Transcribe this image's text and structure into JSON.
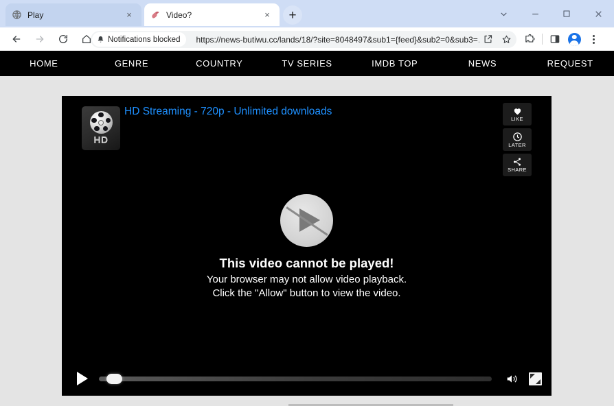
{
  "browser": {
    "tabs": [
      {
        "title": "Play",
        "favicon": "globe-icon",
        "active": false,
        "close_label": "×"
      },
      {
        "title": "Video?",
        "favicon": "video-site-icon",
        "active": true,
        "close_label": "×"
      }
    ],
    "new_tab_label": "+",
    "window_controls": {
      "tab_search": "chevron-down-icon",
      "minimize": "minimize-icon",
      "maximize": "maximize-icon",
      "close": "close-icon"
    },
    "nav": {
      "back": "back-arrow-icon",
      "forward": "forward-arrow-icon",
      "reload": "reload-icon",
      "home": "home-icon"
    },
    "omnibox": {
      "notification_badge": "Notifications blocked",
      "notification_icon": "bell-slash-icon",
      "url": "https://news-butiwu.cc/lands/18/?site=8048497&sub1={feed}&sub2=0&sub3=…",
      "share_icon": "share-icon",
      "bookmark_icon": "star-icon"
    },
    "toolbar_right": {
      "extensions": "puzzle-icon",
      "side_panel": "side-panel-icon",
      "profile": "profile-avatar-icon",
      "menu": "three-dot-menu-icon"
    }
  },
  "site": {
    "nav_items": [
      "HOME",
      "GENRE",
      "COUNTRY",
      "TV SERIES",
      "IMDB TOP",
      "NEWS",
      "REQUEST"
    ],
    "promo": {
      "logo_badge": "HD",
      "logo_icon": "film-reel-icon",
      "title": "HD Streaming - 720p - Unlimited downloads",
      "title_color": "#1e90ff"
    },
    "actions": [
      {
        "label": "LIKE",
        "icon": "heart-icon"
      },
      {
        "label": "LATER",
        "icon": "clock-icon"
      },
      {
        "label": "SHARE",
        "icon": "share-nodes-icon"
      }
    ],
    "player": {
      "play_overlay_icon": "play-disabled-icon",
      "error_headline": "This video cannot be played!",
      "error_line_1": "Your browser may not allow video playback.",
      "error_line_2": "Click the \"Allow\" button to view the video.",
      "controls": {
        "play_icon": "play-icon",
        "progress_percent": 2,
        "volume_icon": "volume-icon",
        "fullscreen_icon": "fullscreen-icon"
      }
    }
  }
}
